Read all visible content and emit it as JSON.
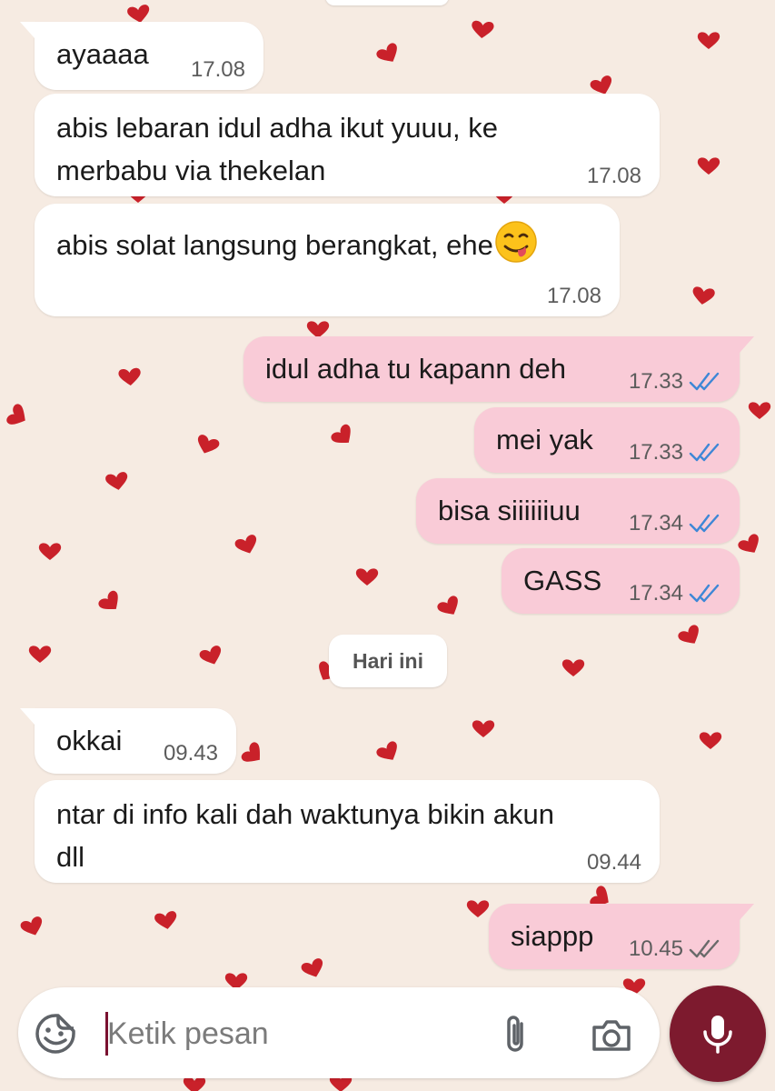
{
  "theme": {
    "wallpaper_color": "#f6ebe2",
    "heart_color": "#c9212a",
    "incoming_bubble_color": "#ffffff",
    "outgoing_bubble_color": "#f9cbd7",
    "read_tick_color": "#3e87d6",
    "delivered_tick_color": "#6a6a6a",
    "mic_button_color": "#7d1a2e"
  },
  "chat": {
    "messages": [
      {
        "direction": "in",
        "text": "ayaaaa",
        "time": "17.08"
      },
      {
        "direction": "in",
        "text": "abis lebaran idul adha ikut yuuu, ke\nmerbabu via thekelan",
        "time": "17.08"
      },
      {
        "direction": "in",
        "text": "abis solat langsung berangkat, ehe",
        "emoji": "face-savoring-food-emoji",
        "time": "17.08"
      },
      {
        "direction": "out",
        "text": "idul adha tu kapann deh",
        "time": "17.33",
        "status": "read"
      },
      {
        "direction": "out",
        "text": "mei yak",
        "time": "17.33",
        "status": "read"
      },
      {
        "direction": "out",
        "text": "bisa siiiiiiuu",
        "time": "17.34",
        "status": "read"
      },
      {
        "direction": "out",
        "text": "GASS",
        "time": "17.34",
        "status": "read"
      },
      {
        "direction": "in",
        "text": "okkai",
        "time": "09.43"
      },
      {
        "direction": "in",
        "text": "ntar di info kali dah waktunya bikin akun\ndll",
        "time": "09.44"
      },
      {
        "direction": "out",
        "text": "siappp",
        "time": "10.45",
        "status": "delivered"
      }
    ],
    "date_divider": "Hari ini"
  },
  "composer": {
    "placeholder": "Ketik pesan",
    "value": "",
    "icons": [
      "sticker-icon",
      "paperclip-icon",
      "camera-icon",
      "microphone-icon"
    ]
  }
}
